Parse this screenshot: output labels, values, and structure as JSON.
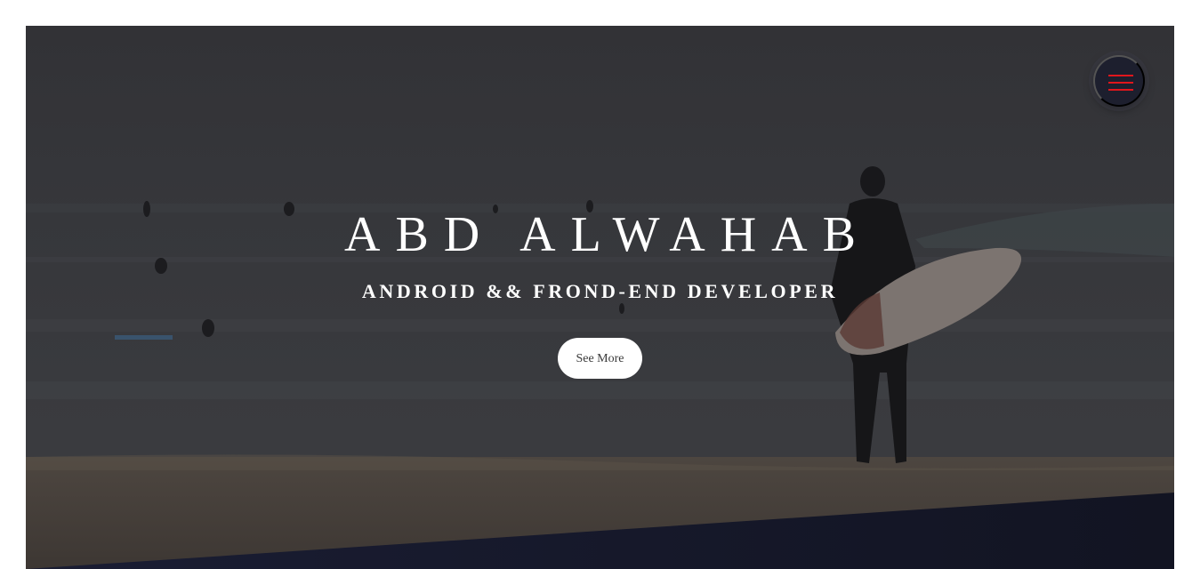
{
  "hero": {
    "title": "ABD ALWAHAB",
    "subtitle": "ANDROID && FROND-END DEVELOPER",
    "cta_label": "See More"
  },
  "menu": {
    "icon": "hamburger-menu-icon",
    "accent_color": "#e0161c"
  },
  "colors": {
    "overlay": "#2f2f33",
    "bottom_band": "#171a2e",
    "button_bg": "#ffffff"
  }
}
